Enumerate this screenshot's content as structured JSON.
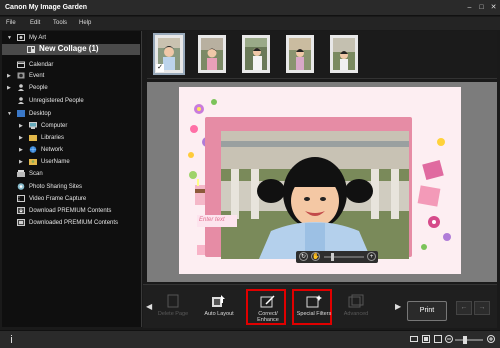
{
  "window": {
    "title": "Canon My Image Garden"
  },
  "menu": [
    "File",
    "Edit",
    "Tools",
    "Help"
  ],
  "sidebar": {
    "items": [
      {
        "label": "My Art",
        "icon": "my-art-icon"
      },
      {
        "label": "New Collage (1)",
        "icon": "collage-icon"
      },
      {
        "label": "Calendar",
        "icon": "calendar-icon"
      },
      {
        "label": "Event",
        "icon": "event-icon"
      },
      {
        "label": "People",
        "icon": "people-icon"
      },
      {
        "label": "Unregistered People",
        "icon": "unregistered-people-icon"
      },
      {
        "label": "Desktop",
        "icon": "desktop-icon"
      },
      {
        "label": "Computer",
        "icon": "computer-icon"
      },
      {
        "label": "Libraries",
        "icon": "libraries-icon"
      },
      {
        "label": "Network",
        "icon": "network-icon"
      },
      {
        "label": "UserName",
        "icon": "user-folder-icon"
      },
      {
        "label": "Scan",
        "icon": "scan-icon"
      },
      {
        "label": "Photo Sharing Sites",
        "icon": "photo-sharing-icon"
      },
      {
        "label": "Video Frame Capture",
        "icon": "video-frame-icon"
      },
      {
        "label": "Download PREMIUM Contents",
        "icon": "download-premium-icon"
      },
      {
        "label": "Downloaded PREMIUM Contents",
        "icon": "downloaded-premium-icon"
      }
    ]
  },
  "collage": {
    "text_placeholder": "Enter text"
  },
  "actions": {
    "delete_page": "Delete Page",
    "auto_layout": "Auto Layout",
    "correct_enhance": "Correct/ Enhance",
    "special_filters": "Special Filters",
    "advanced": "Advanced",
    "print": "Print"
  },
  "colors": {
    "accent_highlight": "#e00000",
    "collage_frame": "#e68ca5",
    "collage_background": "#fdeef2"
  }
}
